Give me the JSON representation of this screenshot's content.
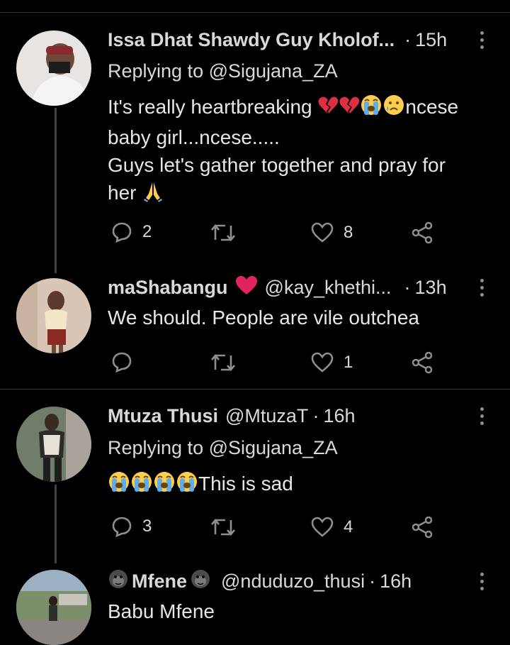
{
  "tweets": [
    {
      "name": "Issa Dhat Shawdy Guy Kholof...",
      "handle": "",
      "time": "15h",
      "replying_to": "Replying to @Sigujana_ZA",
      "text_line1": "It's really heartbreaking ",
      "text_line1_tail": "ncese",
      "text_line2": "baby girl...ncese.....",
      "text_line3": "Guys  let's gather together and pray for",
      "text_line4": "her ",
      "replies": "2",
      "retweets": "",
      "likes": "8",
      "avatar_icon": "person-avatar"
    },
    {
      "name": "maShabangu",
      "handle": "@kay_khethi...",
      "time": "13h",
      "text": "We should. People are vile outchea",
      "replies": "",
      "retweets": "",
      "likes": "1",
      "avatar_icon": "person-avatar"
    },
    {
      "name": "Mtuza Thusi",
      "handle": "@MtuzaT",
      "time": "16h",
      "replying_to": "Replying to @Sigujana_ZA",
      "text": "This is sad",
      "replies": "3",
      "retweets": "",
      "likes": "4",
      "avatar_icon": "person-avatar"
    },
    {
      "name": "Mfene",
      "handle": "@nduduzo_thusi",
      "time": "16h",
      "text": "Babu Mfene",
      "avatar_icon": "person-avatar"
    }
  ],
  "separator": "·",
  "colors": {
    "background": "#000000",
    "text": "#d9d9d9",
    "icon": "#8b8f93",
    "thread_line": "#3d4145",
    "heart_red": "#e0245e"
  }
}
